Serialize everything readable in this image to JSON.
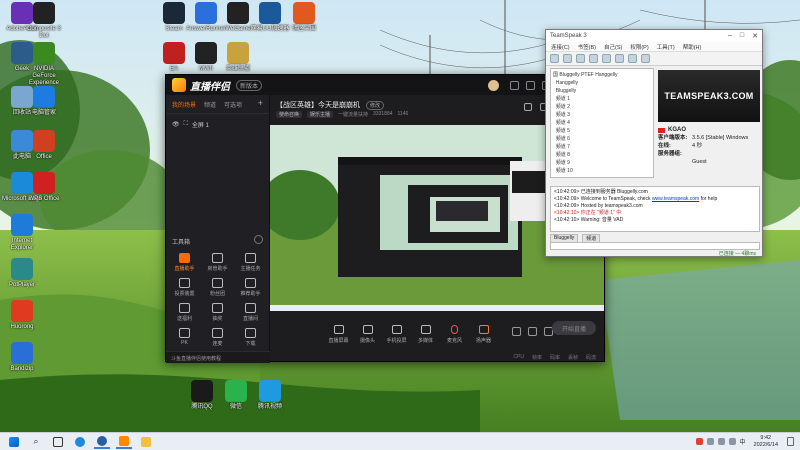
{
  "desktop": {
    "icons": [
      {
        "label": "AdobeAdob",
        "icon": "adobe-icon",
        "color": "#6b2fb5"
      },
      {
        "label": "Composite 3 Dot",
        "icon": "app-icon",
        "color": "#222222"
      },
      {
        "label": "Steam",
        "icon": "steam-icon",
        "color": "#1b2838"
      },
      {
        "label": "AnswerRunner",
        "icon": "app-icon",
        "color": "#2a6fdb"
      },
      {
        "label": "WeGame",
        "icon": "wegame-icon",
        "color": "#222222"
      },
      {
        "label": "网易UU加速器",
        "icon": "uu-icon",
        "color": "#1a5a9a"
      },
      {
        "label": "暗区突围",
        "icon": "game-icon",
        "color": "#e05a20"
      },
      {
        "label": "Geek",
        "icon": "geek-icon",
        "color": "#2b5c8a"
      },
      {
        "label": "NVIDIA GeForce Experience",
        "icon": "nvidia-icon",
        "color": "#3a8a20"
      },
      {
        "label": "EA",
        "icon": "ea-icon",
        "color": "#c02020"
      },
      {
        "label": "MWII",
        "icon": "cod-icon",
        "color": "#222222"
      },
      {
        "label": "英雄联盟",
        "icon": "lol-icon",
        "color": "#c8a23a"
      },
      {
        "label": "回收站",
        "icon": "recycle-bin-icon",
        "color": "#7aa6d0"
      },
      {
        "label": "电脑管家",
        "icon": "shield-icon",
        "color": "#1e7be0"
      },
      {
        "label": "此电脑",
        "icon": "computer-icon",
        "color": "#3a8ad8"
      },
      {
        "label": "Office",
        "icon": "office-icon",
        "color": "#d04020"
      },
      {
        "label": "Microsoft Edge",
        "icon": "edge-icon",
        "color": "#1b8ad8"
      },
      {
        "label": "WPS Office",
        "icon": "wps-icon",
        "color": "#d02020"
      },
      {
        "label": "Internet Explorer",
        "icon": "ie-icon",
        "color": "#1e7bd8"
      },
      {
        "label": "PotPlayer",
        "icon": "player-icon",
        "color": "#2a8a8a"
      },
      {
        "label": "Huorong",
        "icon": "huorong-icon",
        "color": "#e03a20"
      },
      {
        "label": "Bandizip",
        "icon": "bandizip-icon",
        "color": "#2a6fd8"
      },
      {
        "label": "腾讯QQ",
        "icon": "qq-icon",
        "color": "#1a1a1a"
      },
      {
        "label": "微信",
        "icon": "wechat-icon",
        "color": "#2bb24c"
      },
      {
        "label": "腾讯视频",
        "icon": "video-icon",
        "color": "#1e9be0"
      }
    ]
  },
  "stream_app": {
    "brand": "直播伴侣",
    "version": "新版本",
    "left_tabs": [
      "我的场景",
      "频道",
      "可选项"
    ],
    "add_label": "+",
    "scene_label": "全屏 1",
    "tools_title": "工具箱",
    "tools": [
      {
        "label": "直播助手",
        "icon": "record-icon"
      },
      {
        "label": "房管助手",
        "icon": "user-icon"
      },
      {
        "label": "主播任务",
        "icon": "task-icon"
      },
      {
        "label": "投票装置",
        "icon": "vote-icon"
      },
      {
        "label": "粉丝团",
        "icon": "fans-icon"
      },
      {
        "label": "推荐助手",
        "icon": "recommend-icon"
      },
      {
        "label": "送福利",
        "icon": "gift-icon"
      },
      {
        "label": "抽奖",
        "icon": "lottery-icon"
      },
      {
        "label": "直播间",
        "icon": "calendar-icon"
      },
      {
        "label": "PK",
        "icon": "pk-icon"
      },
      {
        "label": "连麦",
        "icon": "link-icon"
      },
      {
        "label": "下载",
        "icon": "download-icon"
      }
    ],
    "announcement": "斗鱼直播伴侣使用教程",
    "room_title": "【战区英雄】今天是崩崩机",
    "edit_label": "修改",
    "room_tags": [
      "使命召唤",
      "娱乐主播"
    ],
    "room_meta": [
      "一键流量扶持",
      "3331884",
      "1146"
    ],
    "bottom_controls": [
      {
        "label": "直播屏幕",
        "icon": "screen-icon"
      },
      {
        "label": "摄像头",
        "icon": "camera-icon"
      },
      {
        "label": "手机投屏",
        "icon": "phone-icon"
      },
      {
        "label": "多媒体",
        "icon": "media-icon"
      },
      {
        "label": "麦克风",
        "icon": "mic-icon"
      },
      {
        "label": "扬声器",
        "icon": "speaker-icon"
      }
    ],
    "start_label": "开始直播",
    "status_items": [
      "CPU",
      "帧率",
      "码率",
      "丢帧",
      "码流"
    ]
  },
  "teamspeak": {
    "title": "TeamSpeak 3",
    "menu": [
      "连接(C)",
      "书签(B)",
      "自己(S)",
      "权限(P)",
      "工具(T)",
      "帮助(H)"
    ],
    "tree": [
      "国 Bluggelly PTEF Hanggelly",
      "  Hanggelly",
      "  Bluggelly",
      "  频道 1",
      "  频道 2",
      "  频道 3",
      "  频道 4",
      "  频道 5",
      "  频道 6",
      "  频道 7",
      "  频道 8",
      "  频道 9",
      "  频道 10"
    ],
    "banner": "TEAMSPEAK3.COM",
    "nickname": "KGAO",
    "info_rows": [
      {
        "key": "客户端版本:",
        "value": "3.5.6 [Stable] Windows"
      },
      {
        "key": "在线:",
        "value": "4 秒"
      },
      {
        "key": "服务器组:",
        "value": ""
      },
      {
        "key": "",
        "value": "Guest"
      }
    ],
    "chat_lines": [
      "<10:42:09> 已连接到服务器 Bluggelly.com",
      "<10:42:09> Welcome to TeamSpeak, check ",
      "www.teamspeak.com",
      " for help",
      "<10:42:09> Hosted by teamspeak3.com",
      "<10:42:10> 你正在 \"频道 1\" 中",
      "<10:42:10> Warning: 音量 VAD"
    ],
    "tabs": [
      "Bluggelly",
      "频道"
    ],
    "status": "已连接 — 4聊ms"
  },
  "taskbar": {
    "items": [
      "start-icon",
      "search-icon",
      "taskview-icon",
      "edge-icon",
      "teamspeak-icon",
      "streaming-app-icon",
      "explorer-icon"
    ],
    "time": "9:42",
    "date": "2022/6/14",
    "lang": "中"
  }
}
